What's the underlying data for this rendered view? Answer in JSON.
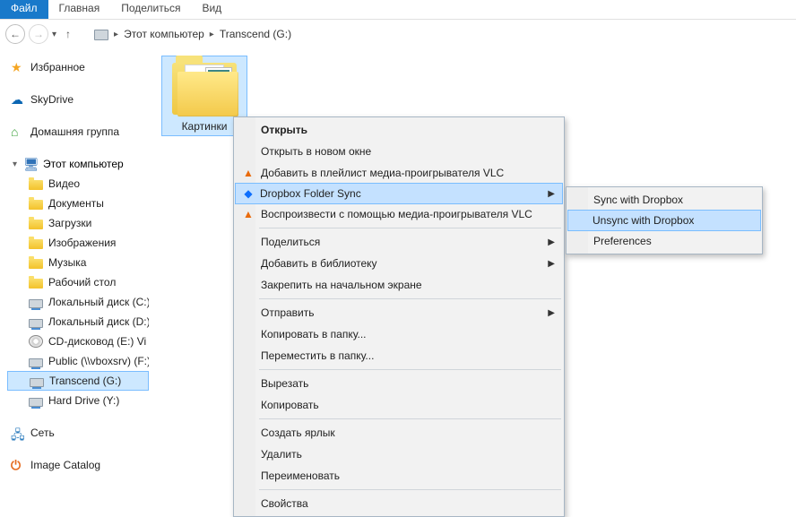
{
  "ribbon": {
    "tabs": [
      "Файл",
      "Главная",
      "Поделиться",
      "Вид"
    ],
    "active_index": 0
  },
  "breadcrumb": {
    "root": "Этот компьютер",
    "loc": "Transcend (G:)"
  },
  "sidebar": {
    "favorites": "Избранное",
    "skydrive": "SkyDrive",
    "homegroup": "Домашняя группа",
    "this_pc": "Этот компьютер",
    "items": [
      "Видео",
      "Документы",
      "Загрузки",
      "Изображения",
      "Музыка",
      "Рабочий стол",
      "Локальный диск (C:)",
      "Локальный диск (D:)",
      "CD-дисковод (E:) Vi",
      "Public (\\\\vboxsrv) (F:)",
      "Transcend (G:)",
      "Hard Drive (Y:)"
    ],
    "selected_index": 10,
    "network": "Сеть",
    "image_catalog": "Image Catalog"
  },
  "tile": {
    "name": "Картинки"
  },
  "context_menu": {
    "open": "Открыть",
    "open_new": "Открыть в новом окне",
    "vlc_playlist": "Добавить в плейлист медиа-проигрывателя VLC",
    "dropbox": "Dropbox Folder Sync",
    "vlc_play": "Воспроизвести с помощью медиа-проигрывателя VLC",
    "share": "Поделиться",
    "add_lib": "Добавить в библиотеку",
    "pin_start": "Закрепить на начальном экране",
    "send_to": "Отправить",
    "copy_to": "Копировать в папку...",
    "move_to": "Переместить в папку...",
    "cut": "Вырезать",
    "copy": "Копировать",
    "shortcut": "Создать ярлык",
    "delete": "Удалить",
    "rename": "Переименовать",
    "props": "Свойства"
  },
  "submenu": {
    "sync": "Sync with Dropbox",
    "unsync": "Unsync with Dropbox",
    "prefs": "Preferences"
  }
}
